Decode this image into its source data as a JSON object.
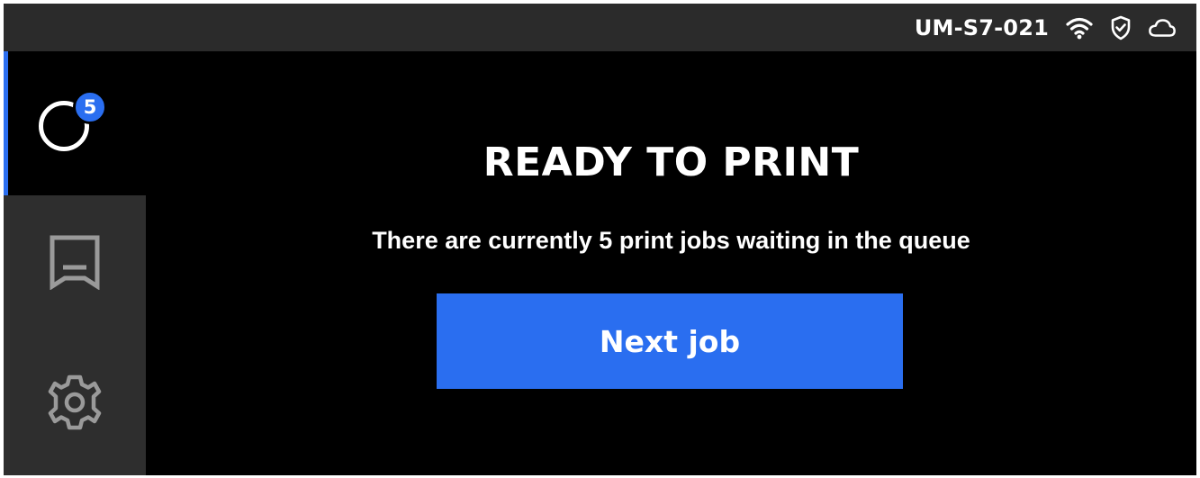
{
  "status_bar": {
    "device_id": "UM-S7-021",
    "icons": [
      "wifi-icon",
      "shield-check-icon",
      "cloud-icon"
    ]
  },
  "sidebar": {
    "items": [
      {
        "name": "queue",
        "icon": "queue-ring-icon",
        "badge": "5",
        "active": true
      },
      {
        "name": "library",
        "icon": "tray-icon",
        "active": false
      },
      {
        "name": "settings",
        "icon": "gear-icon",
        "active": false
      }
    ]
  },
  "main": {
    "title": "READY TO PRINT",
    "subtitle": "There are currently 5 print jobs waiting in the queue",
    "next_button_label": "Next job"
  },
  "colors": {
    "accent": "#2a6ef0",
    "background": "#000000",
    "status_bar": "#2b2b2b",
    "sidebar": "#2e2e2e",
    "text": "#ffffff",
    "icon_inactive": "#9a9a9a"
  }
}
